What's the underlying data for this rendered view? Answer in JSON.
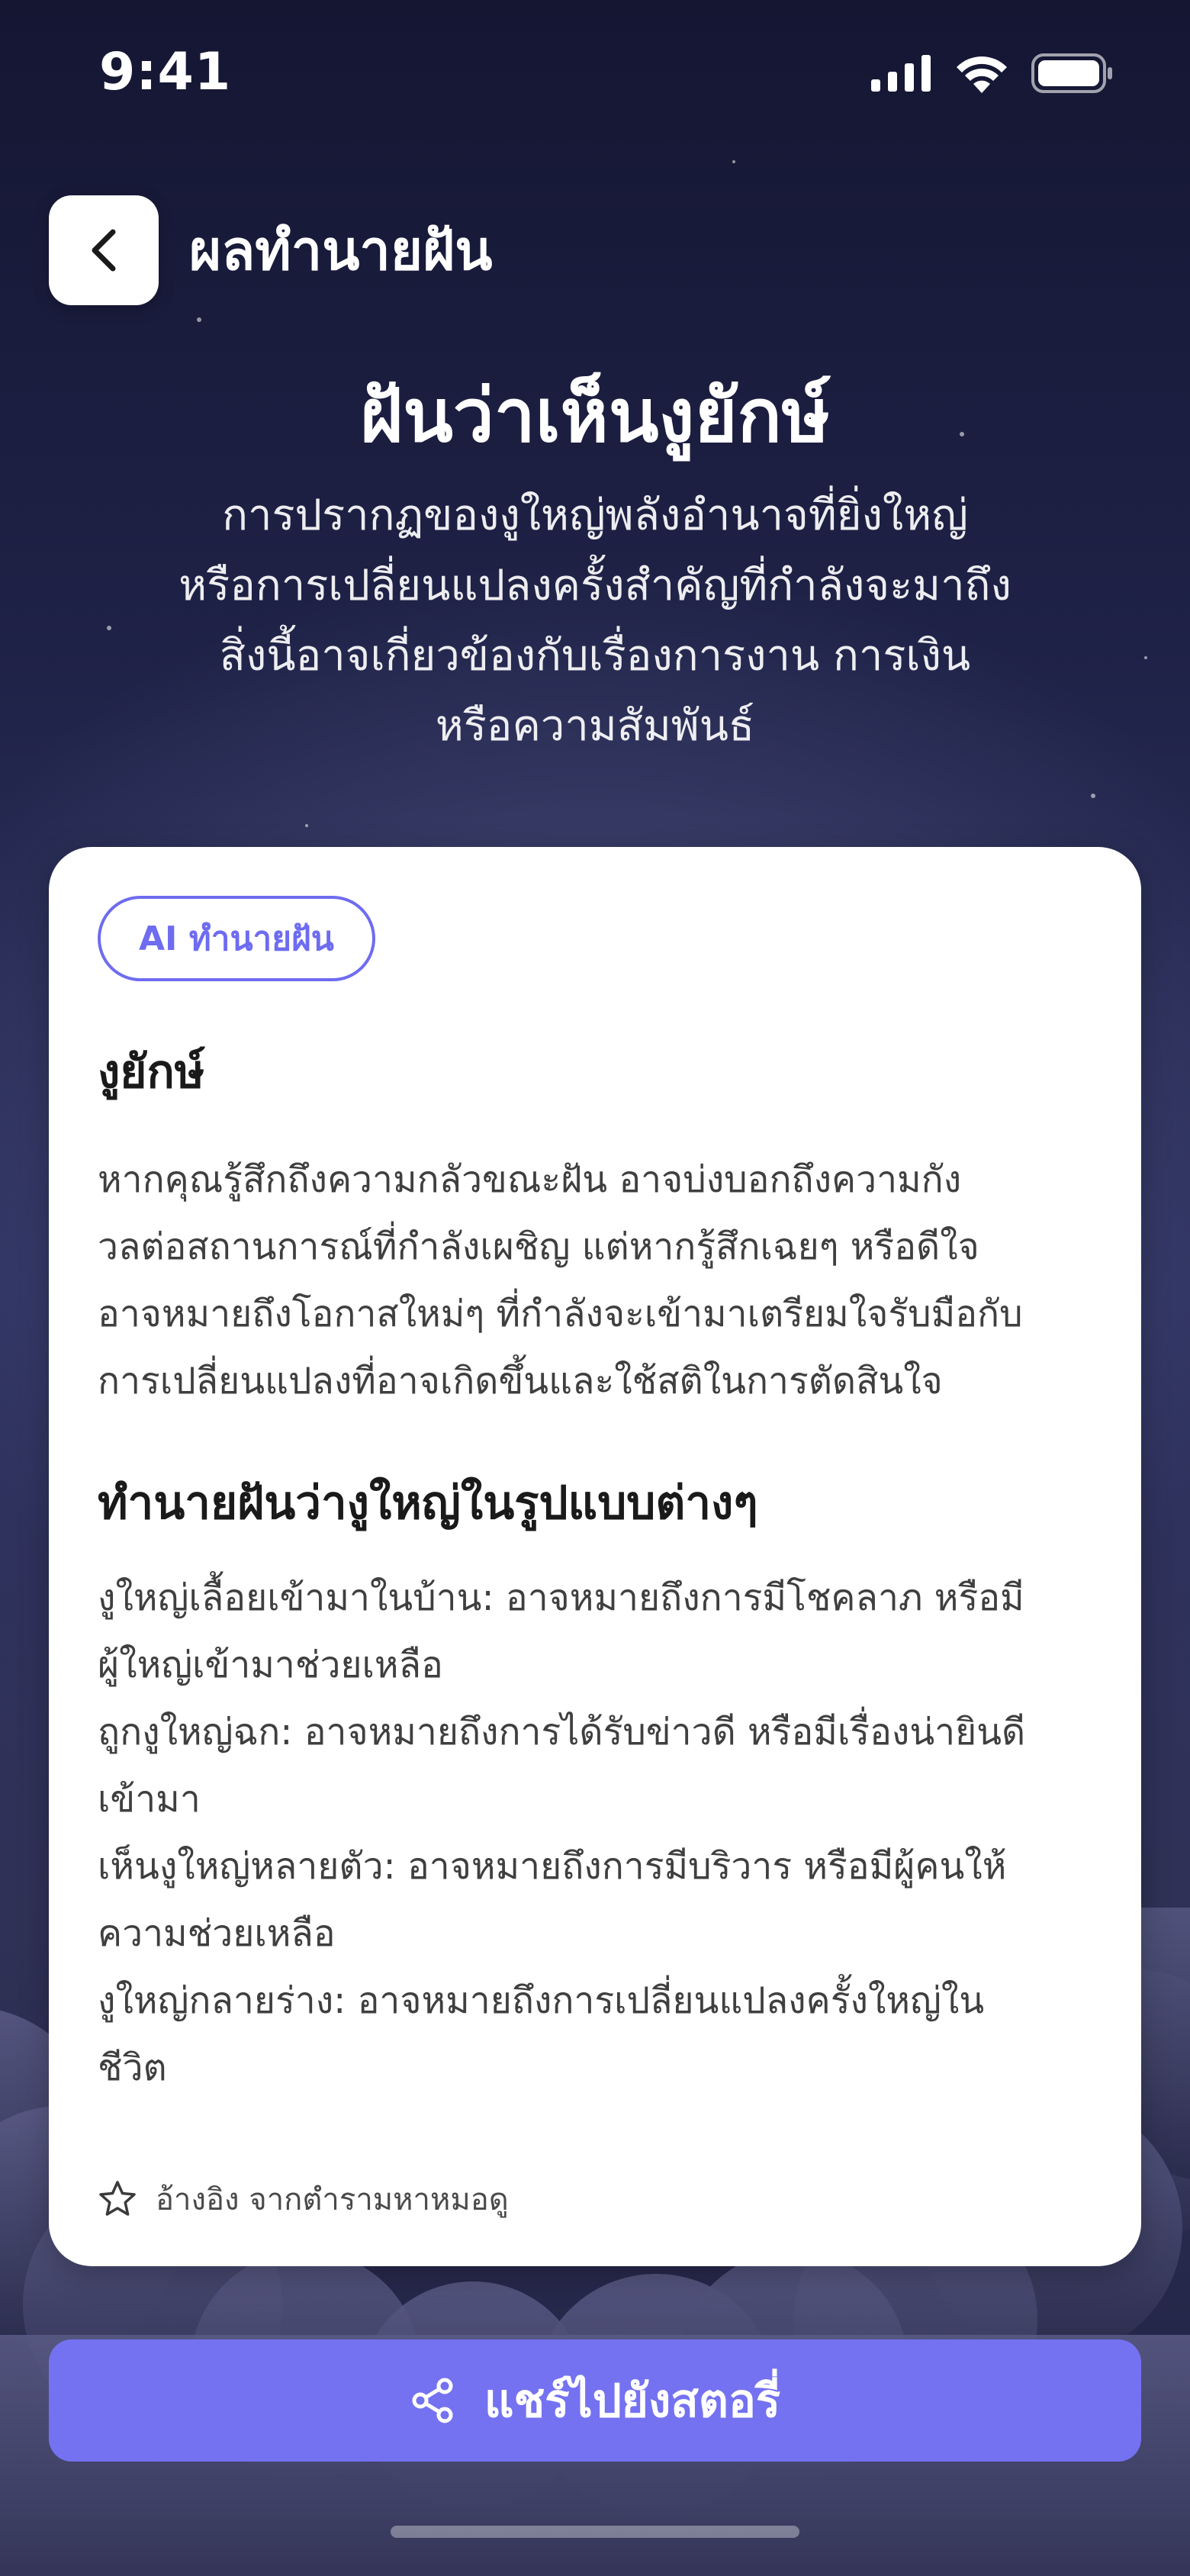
{
  "status_bar": {
    "time": "9:41"
  },
  "header": {
    "back_icon": "chevron-left-icon",
    "title": "ผลทำนายฝัน"
  },
  "hero": {
    "title": "ฝันว่าเห็นงูยักษ์",
    "description_lines": [
      "การปรากฏของงูใหญ่พลังอำนาจที่ยิ่งใหญ่",
      "หรือการเปลี่ยนแปลงครั้งสำคัญที่กำลังจะมาถึง",
      "สิ่งนี้อาจเกี่ยวข้องกับเรื่องการงาน การเงิน",
      "หรือความสัมพันธ์"
    ]
  },
  "card": {
    "badge": "AI ทำนายฝัน",
    "section1": {
      "title": "งูยักษ์",
      "lines": [
        "หากคุณรู้สึกถึงความกลัวขณะฝัน อาจบ่งบอกถึงความกัง",
        "วลต่อสถานการณ์ที่กำลังเผชิญ แต่หากรู้สึกเฉยๆ หรือดีใจ",
        "อาจหมายถึงโอกาสใหม่ๆ ที่กำลังจะเข้ามาเตรียมใจรับมือกับ",
        "การเปลี่ยนแปลงที่อาจเกิดขึ้นและใช้สติในการตัดสินใจ"
      ]
    },
    "section2": {
      "title": "ทำนายฝันว่างูใหญ่ในรูปแบบต่างๆ",
      "lines": [
        "งูใหญ่เลื้อยเข้ามาในบ้าน: อาจหมายถึงการมีโชคลาภ หรือมี",
        "ผู้ใหญ่เข้ามาช่วยเหลือ",
        "ถูกงูใหญ่ฉก: อาจหมายถึงการได้รับข่าวดี หรือมีเรื่องน่ายินดี",
        "เข้ามา",
        "เห็นงูใหญ่หลายตัว: อาจหมายถึงการมีบริวาร หรือมีผู้คนให้",
        "ความช่วยเหลือ",
        "งูใหญ่กลายร่าง: อาจหมายถึงการเปลี่ยนแปลงครั้งใหญ่ใน",
        "ชีวิต"
      ]
    },
    "reference": {
      "icon": "star-outline-icon",
      "text": "อ้างอิง จากตำรามหาหมอดู"
    }
  },
  "share_button": {
    "icon": "share-icon",
    "label": "แชร์ไปยังสตอรี่"
  },
  "colors": {
    "accent": "#7472f1",
    "badge_border": "#6e6cf0",
    "background_top": "#141632",
    "background_bottom": "#1f2142"
  }
}
